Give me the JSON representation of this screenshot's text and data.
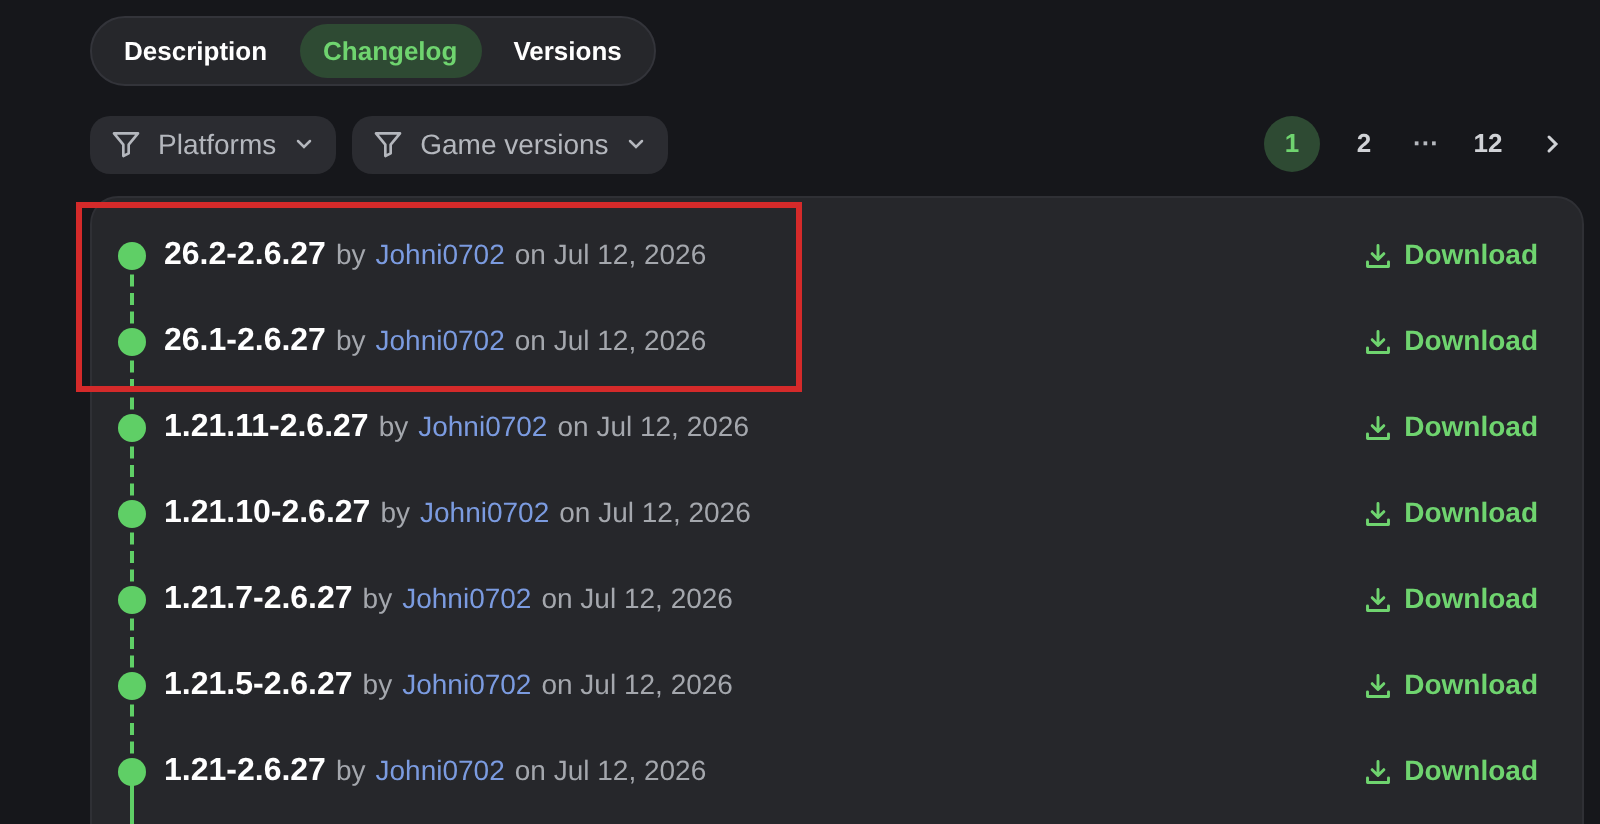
{
  "tabs": [
    {
      "label": "Description",
      "selected": false
    },
    {
      "label": "Changelog",
      "selected": true
    },
    {
      "label": "Versions",
      "selected": false
    }
  ],
  "filters": [
    {
      "label": "Platforms"
    },
    {
      "label": "Game versions"
    }
  ],
  "pagination": {
    "pages": [
      {
        "label": "1",
        "selected": true
      },
      {
        "label": "2",
        "selected": false
      },
      {
        "label": "···",
        "kind": "ellipsis"
      },
      {
        "label": "12",
        "selected": false
      }
    ]
  },
  "versions": [
    {
      "version": "26.2-2.6.27",
      "by": "by",
      "author": "Johni0702",
      "date": "on Jul 12, 2026",
      "action": "Download",
      "highlighted": true
    },
    {
      "version": "26.1-2.6.27",
      "by": "by",
      "author": "Johni0702",
      "date": "on Jul 12, 2026",
      "action": "Download",
      "highlighted": true
    },
    {
      "version": "1.21.11-2.6.27",
      "by": "by",
      "author": "Johni0702",
      "date": "on Jul 12, 2026",
      "action": "Download",
      "highlighted": false
    },
    {
      "version": "1.21.10-2.6.27",
      "by": "by",
      "author": "Johni0702",
      "date": "on Jul 12, 2026",
      "action": "Download",
      "highlighted": false
    },
    {
      "version": "1.21.7-2.6.27",
      "by": "by",
      "author": "Johni0702",
      "date": "on Jul 12, 2026",
      "action": "Download",
      "highlighted": false
    },
    {
      "version": "1.21.5-2.6.27",
      "by": "by",
      "author": "Johni0702",
      "date": "on Jul 12, 2026",
      "action": "Download",
      "highlighted": false
    },
    {
      "version": "1.21-2.6.27",
      "by": "by",
      "author": "Johni0702",
      "date": "on Jul 12, 2026",
      "action": "Download",
      "highlighted": false
    }
  ]
}
